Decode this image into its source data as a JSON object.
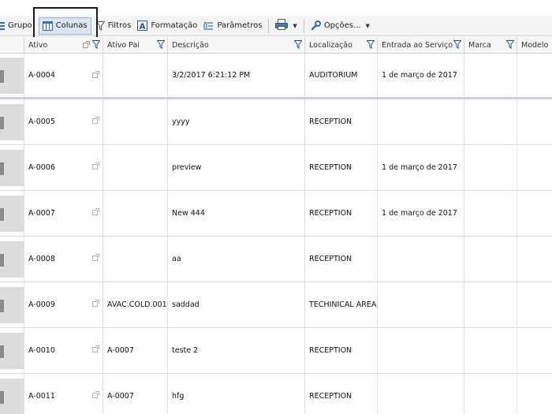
{
  "toolbar": {
    "group_label": "Grupo",
    "columns_label": "Colunas",
    "filters_label": "Filtros",
    "formatting_label": "Formatação",
    "parameters_label": "Parâmetros",
    "options_label": "Opções..."
  },
  "columns": [
    {
      "label": "Ativo"
    },
    {
      "label": "Ativo Pai"
    },
    {
      "label": "Descrição"
    },
    {
      "label": "Localização"
    },
    {
      "label": "Entrada ao Serviço"
    },
    {
      "label": "Marca"
    },
    {
      "label": "Modelo"
    }
  ],
  "rows": [
    {
      "ativo": "A-0004",
      "ativo_pai": "",
      "descricao": "3/2/2017 6:21:12 PM",
      "localizacao": "AUDITORIUM",
      "entrada": "1 de março de 2017",
      "marca": "",
      "modelo": ""
    },
    {
      "ativo": "A-0005",
      "ativo_pai": "",
      "descricao": "yyyy",
      "localizacao": "RECEPTION",
      "entrada": "",
      "marca": "",
      "modelo": ""
    },
    {
      "ativo": "A-0006",
      "ativo_pai": "",
      "descricao": "preview",
      "localizacao": "RECEPTION",
      "entrada": "1 de março de 2017",
      "marca": "",
      "modelo": ""
    },
    {
      "ativo": "A-0007",
      "ativo_pai": "",
      "descricao": "New 444",
      "localizacao": "RECEPTION",
      "entrada": "1 de março de 2017",
      "marca": "",
      "modelo": ""
    },
    {
      "ativo": "A-0008",
      "ativo_pai": "",
      "descricao": "aa",
      "localizacao": "RECEPTION",
      "entrada": "",
      "marca": "",
      "modelo": ""
    },
    {
      "ativo": "A-0009",
      "ativo_pai": "AVAC.COLD.001",
      "descricao": "saddad",
      "localizacao": "TECHINICAL AREA",
      "entrada": "",
      "marca": "",
      "modelo": ""
    },
    {
      "ativo": "A-0010",
      "ativo_pai": "A-0007",
      "descricao": "teste 2",
      "localizacao": "RECEPTION",
      "entrada": "",
      "marca": "",
      "modelo": ""
    },
    {
      "ativo": "A-0011",
      "ativo_pai": "A-0007",
      "descricao": "hfg",
      "localizacao": "RECEPTION",
      "entrada": "",
      "marca": "",
      "modelo": ""
    }
  ]
}
